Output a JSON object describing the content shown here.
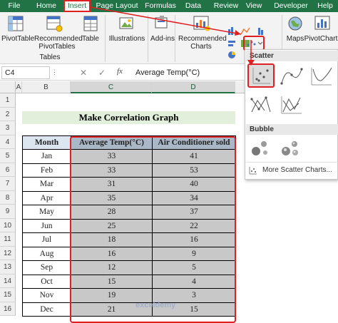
{
  "ribbon": {
    "tabs": [
      "File",
      "Home",
      "Insert",
      "Page Layout",
      "Formulas",
      "Data",
      "Review",
      "View",
      "Developer",
      "Help"
    ],
    "active_tab": "Insert",
    "pivottable_label": "PivotTable",
    "recommended_pivottables_label": "Recommended PivotTables",
    "table_label": "Table",
    "tables_group_label": "Tables",
    "illustrations_label": "Illustrations",
    "addins_label": "Add-ins",
    "recommended_charts_label": "Recommended Charts",
    "maps_label": "Maps",
    "pivotchart_label": "PivotChart"
  },
  "formula_bar": {
    "name_box": "C4",
    "formula": "Average Temp(°C)"
  },
  "sheet": {
    "columns": [
      "A",
      "B",
      "C",
      "D"
    ],
    "selected_columns": [
      "C",
      "D"
    ],
    "rows": [
      "1",
      "2",
      "3",
      "4",
      "5",
      "6",
      "7",
      "8",
      "9",
      "10",
      "11",
      "12",
      "13",
      "14",
      "15",
      "16"
    ],
    "title": "Make Correlation Graph",
    "headers": [
      "Month",
      "Average Temp(°C)",
      "Air Conditioner sold"
    ],
    "data": [
      [
        "Jan",
        "33",
        "41"
      ],
      [
        "Feb",
        "33",
        "53"
      ],
      [
        "Mar",
        "31",
        "40"
      ],
      [
        "Apr",
        "35",
        "34"
      ],
      [
        "May",
        "28",
        "37"
      ],
      [
        "Jun",
        "25",
        "22"
      ],
      [
        "Jul",
        "18",
        "16"
      ],
      [
        "Aug",
        "16",
        "9"
      ],
      [
        "Sep",
        "12",
        "5"
      ],
      [
        "Oct",
        "15",
        "4"
      ],
      [
        "Nov",
        "19",
        "3"
      ],
      [
        "Dec",
        "21",
        "15"
      ]
    ],
    "watermark": "exceldemy"
  },
  "scatter_menu": {
    "scatter_heading": "Scatter",
    "bubble_heading": "Bubble",
    "more_link": "More Scatter Charts..."
  },
  "colors": {
    "excel_green": "#217346",
    "highlight_red": "#e02020",
    "title_fill": "#e2efda",
    "header_fill": "#dce6f1",
    "selection_fill": "#c8c8c8"
  }
}
